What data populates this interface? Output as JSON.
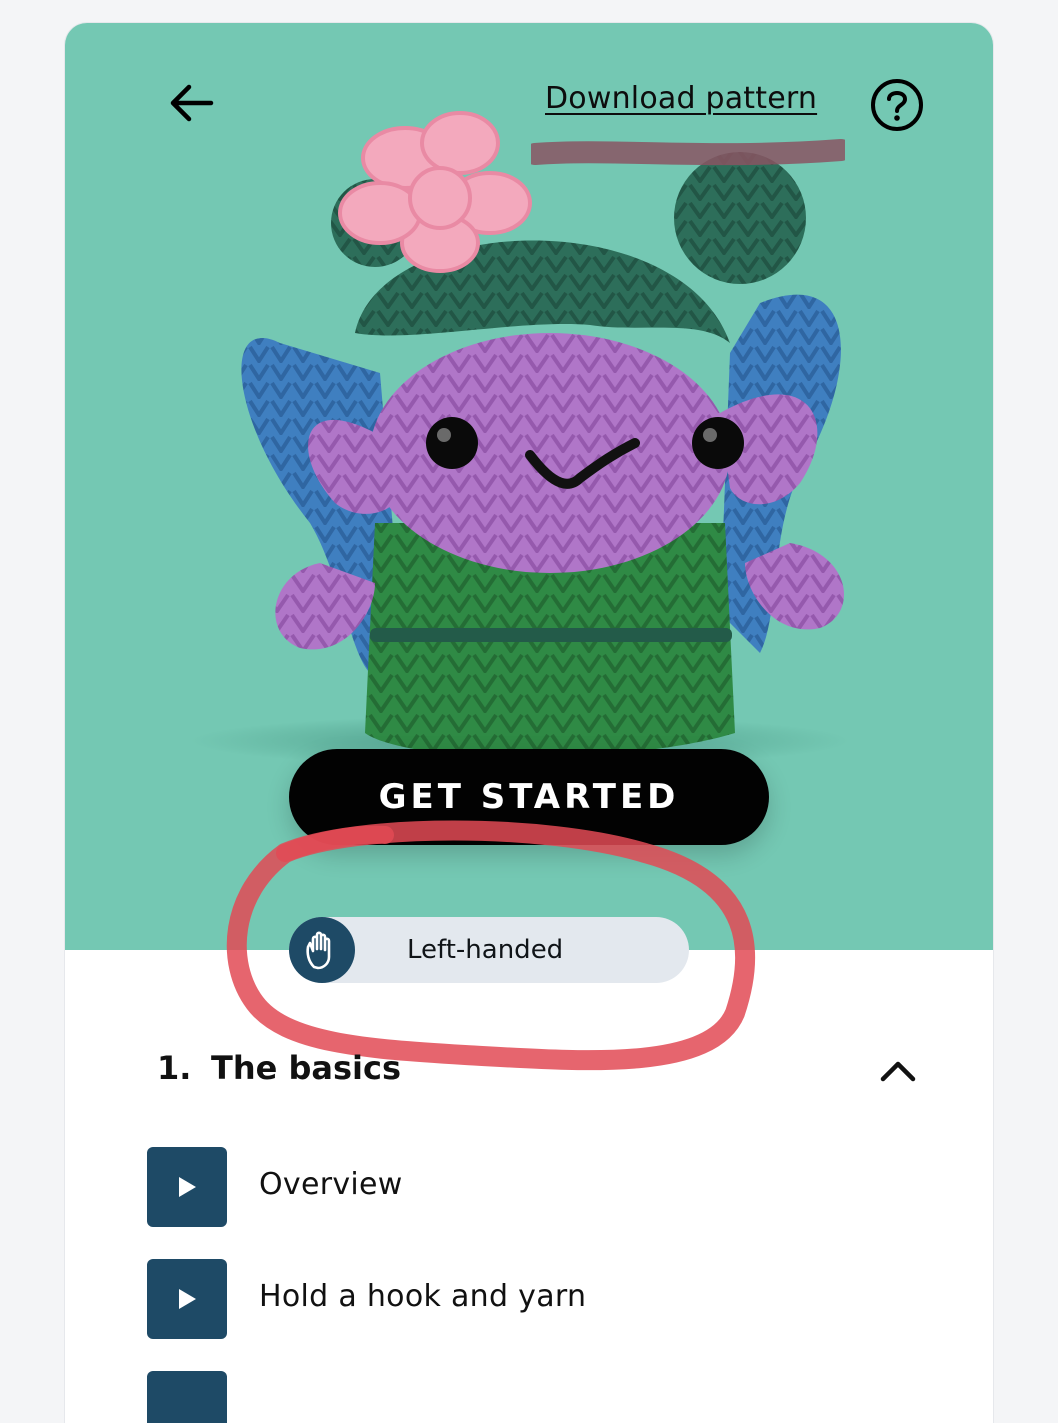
{
  "header": {
    "download_label": "Download pattern"
  },
  "hero": {
    "background_color": "#74c8b3",
    "image_description_icon": "crochet-fairy-image",
    "cta_label": "GET STARTED"
  },
  "handedness_toggle": {
    "label": "Left-handed",
    "icon": "hand-icon"
  },
  "section": {
    "number": "1.",
    "title": "The basics",
    "expanded": true,
    "lessons": [
      {
        "label": "Overview"
      },
      {
        "label": "Hold a hook and yarn"
      },
      {
        "label": ""
      }
    ]
  },
  "colors": {
    "accent": "#1e4a66",
    "cta": "#020202",
    "annotation": "#e24a55"
  }
}
